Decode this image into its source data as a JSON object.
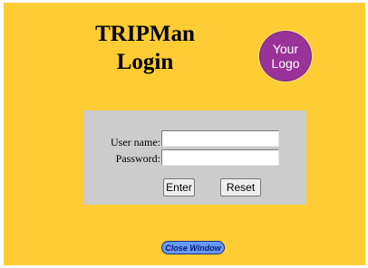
{
  "header": {
    "title_line1": "TRIPMan",
    "title_line2": "Login"
  },
  "logo": {
    "line1": "Your",
    "line2": "Logo"
  },
  "login_form": {
    "username_label": "User name:",
    "username_value": "",
    "password_label": "Password:",
    "password_value": "",
    "enter_label": "Enter",
    "reset_label": "Reset"
  },
  "footer": {
    "close_label": "Close Window"
  },
  "colors": {
    "background": "#FFCC33",
    "panel": "#CCCCCC",
    "logo": "#993399",
    "close_button": "#6699FF"
  }
}
